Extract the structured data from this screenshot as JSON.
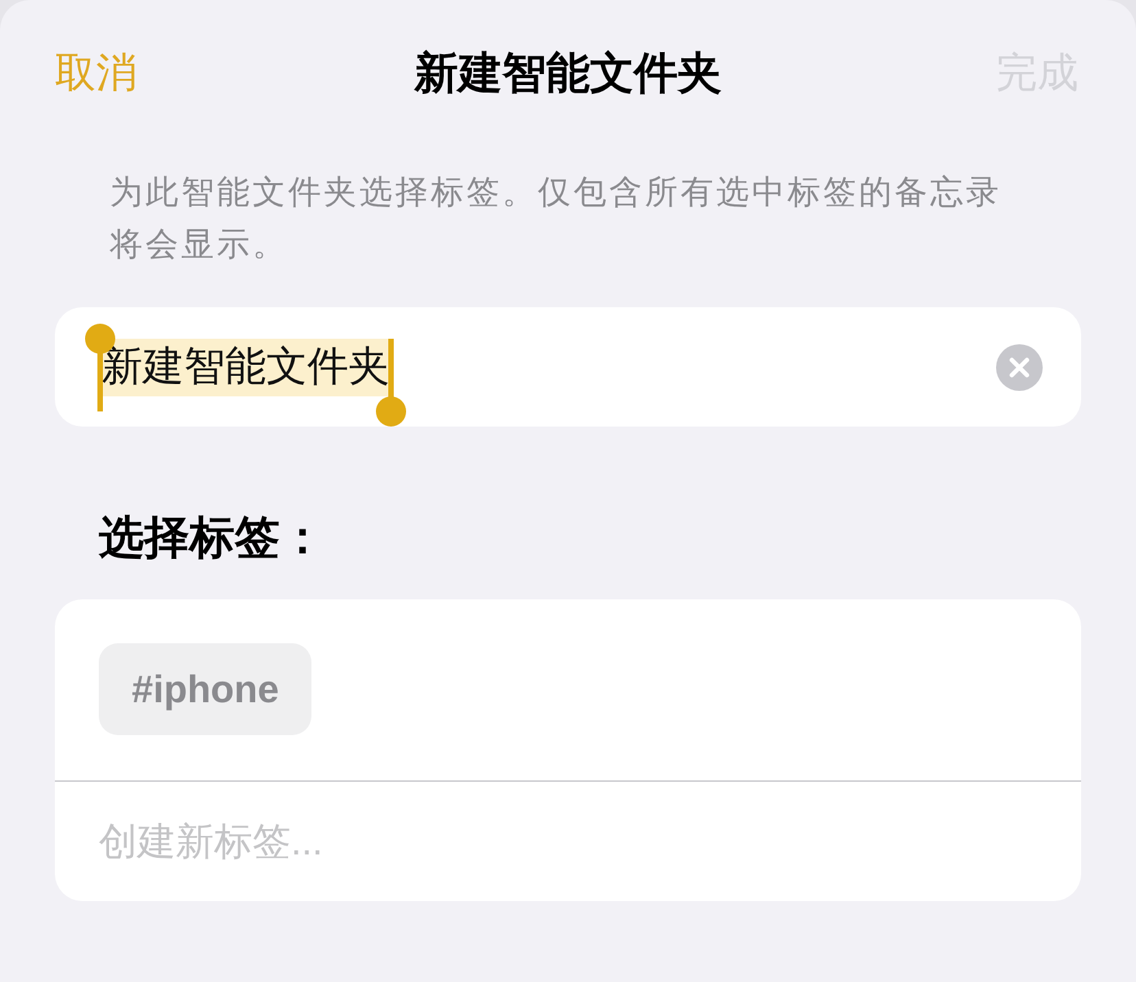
{
  "navigation": {
    "cancel": "取消",
    "title": "新建智能文件夹",
    "done": {
      "label": "完成",
      "disabled": true
    }
  },
  "description": "为此智能文件夹选择标签。仅包含所有选中标签的备忘录将会显示。",
  "name_field": {
    "value": "新建智能文件夹",
    "selected": true
  },
  "tags_section": {
    "heading": "选择标签：",
    "tags": [
      {
        "label": "#iphone",
        "selected": false
      }
    ],
    "new_tag_field": {
      "placeholder": "创建新标签..."
    }
  }
}
